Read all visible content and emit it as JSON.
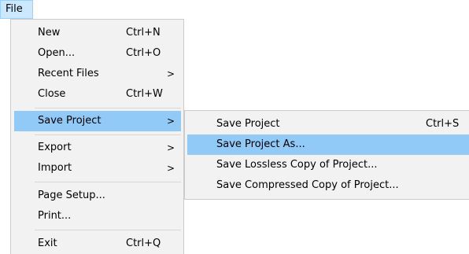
{
  "menubar": {
    "file_label": "File"
  },
  "file_menu": {
    "items": [
      {
        "label": "New",
        "shortcut": "Ctrl+N"
      },
      {
        "label": "Open...",
        "shortcut": "Ctrl+O"
      },
      {
        "label": "Recent Files",
        "shortcut": "",
        "arrow": ">"
      },
      {
        "label": "Close",
        "shortcut": "Ctrl+W"
      },
      {
        "label": "Save Project",
        "shortcut": "",
        "arrow": ">"
      },
      {
        "label": "Export",
        "shortcut": "",
        "arrow": ">"
      },
      {
        "label": "Import",
        "shortcut": "",
        "arrow": ">"
      },
      {
        "label": "Page Setup...",
        "shortcut": ""
      },
      {
        "label": "Print...",
        "shortcut": ""
      },
      {
        "label": "Exit",
        "shortcut": "Ctrl+Q"
      }
    ],
    "highlighted_item": "Save Project"
  },
  "save_project_submenu": {
    "items": [
      {
        "label": "Save Project",
        "shortcut": "Ctrl+S"
      },
      {
        "label": "Save Project As...",
        "shortcut": ""
      },
      {
        "label": "Save Lossless Copy of Project...",
        "shortcut": ""
      },
      {
        "label": "Save Compressed Copy of Project...",
        "shortcut": ""
      }
    ],
    "highlighted_item": "Save Project As..."
  },
  "colors": {
    "menu_background": "#f2f2f2",
    "highlight": "#91c9f7",
    "menubar_active": "#cce8ff",
    "separator": "#d7d7d7"
  }
}
